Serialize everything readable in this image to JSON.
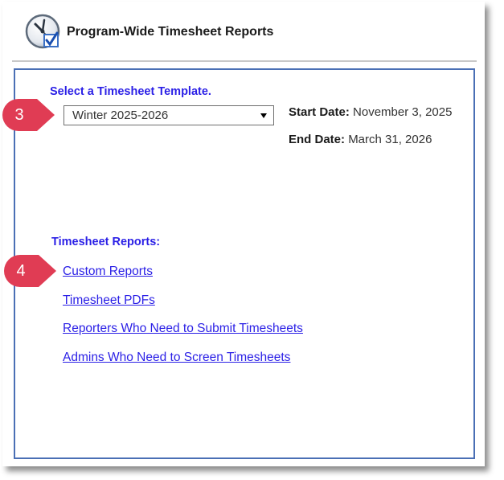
{
  "header": {
    "title": "Program-Wide Timesheet Reports",
    "logo_icon": "clock-checkmark-icon"
  },
  "template": {
    "label": "Select a Timesheet Template.",
    "selected": "Winter 2025-2026"
  },
  "dates": {
    "start_label": "Start Date:",
    "start_value": "November 3, 2025",
    "end_label": "End Date:",
    "end_value": "March 31, 2026"
  },
  "reports": {
    "label": "Timesheet Reports:",
    "links": [
      "Custom Reports",
      "Timesheet PDFs",
      "Reporters Who Need to Submit Timesheets",
      "Admins Who Need to Screen Timesheets"
    ]
  },
  "callouts": [
    "3",
    "4"
  ],
  "colors": {
    "accent_text": "#2a1fe6",
    "panel_border": "#4a6fb5",
    "callout": "#e03c54"
  }
}
